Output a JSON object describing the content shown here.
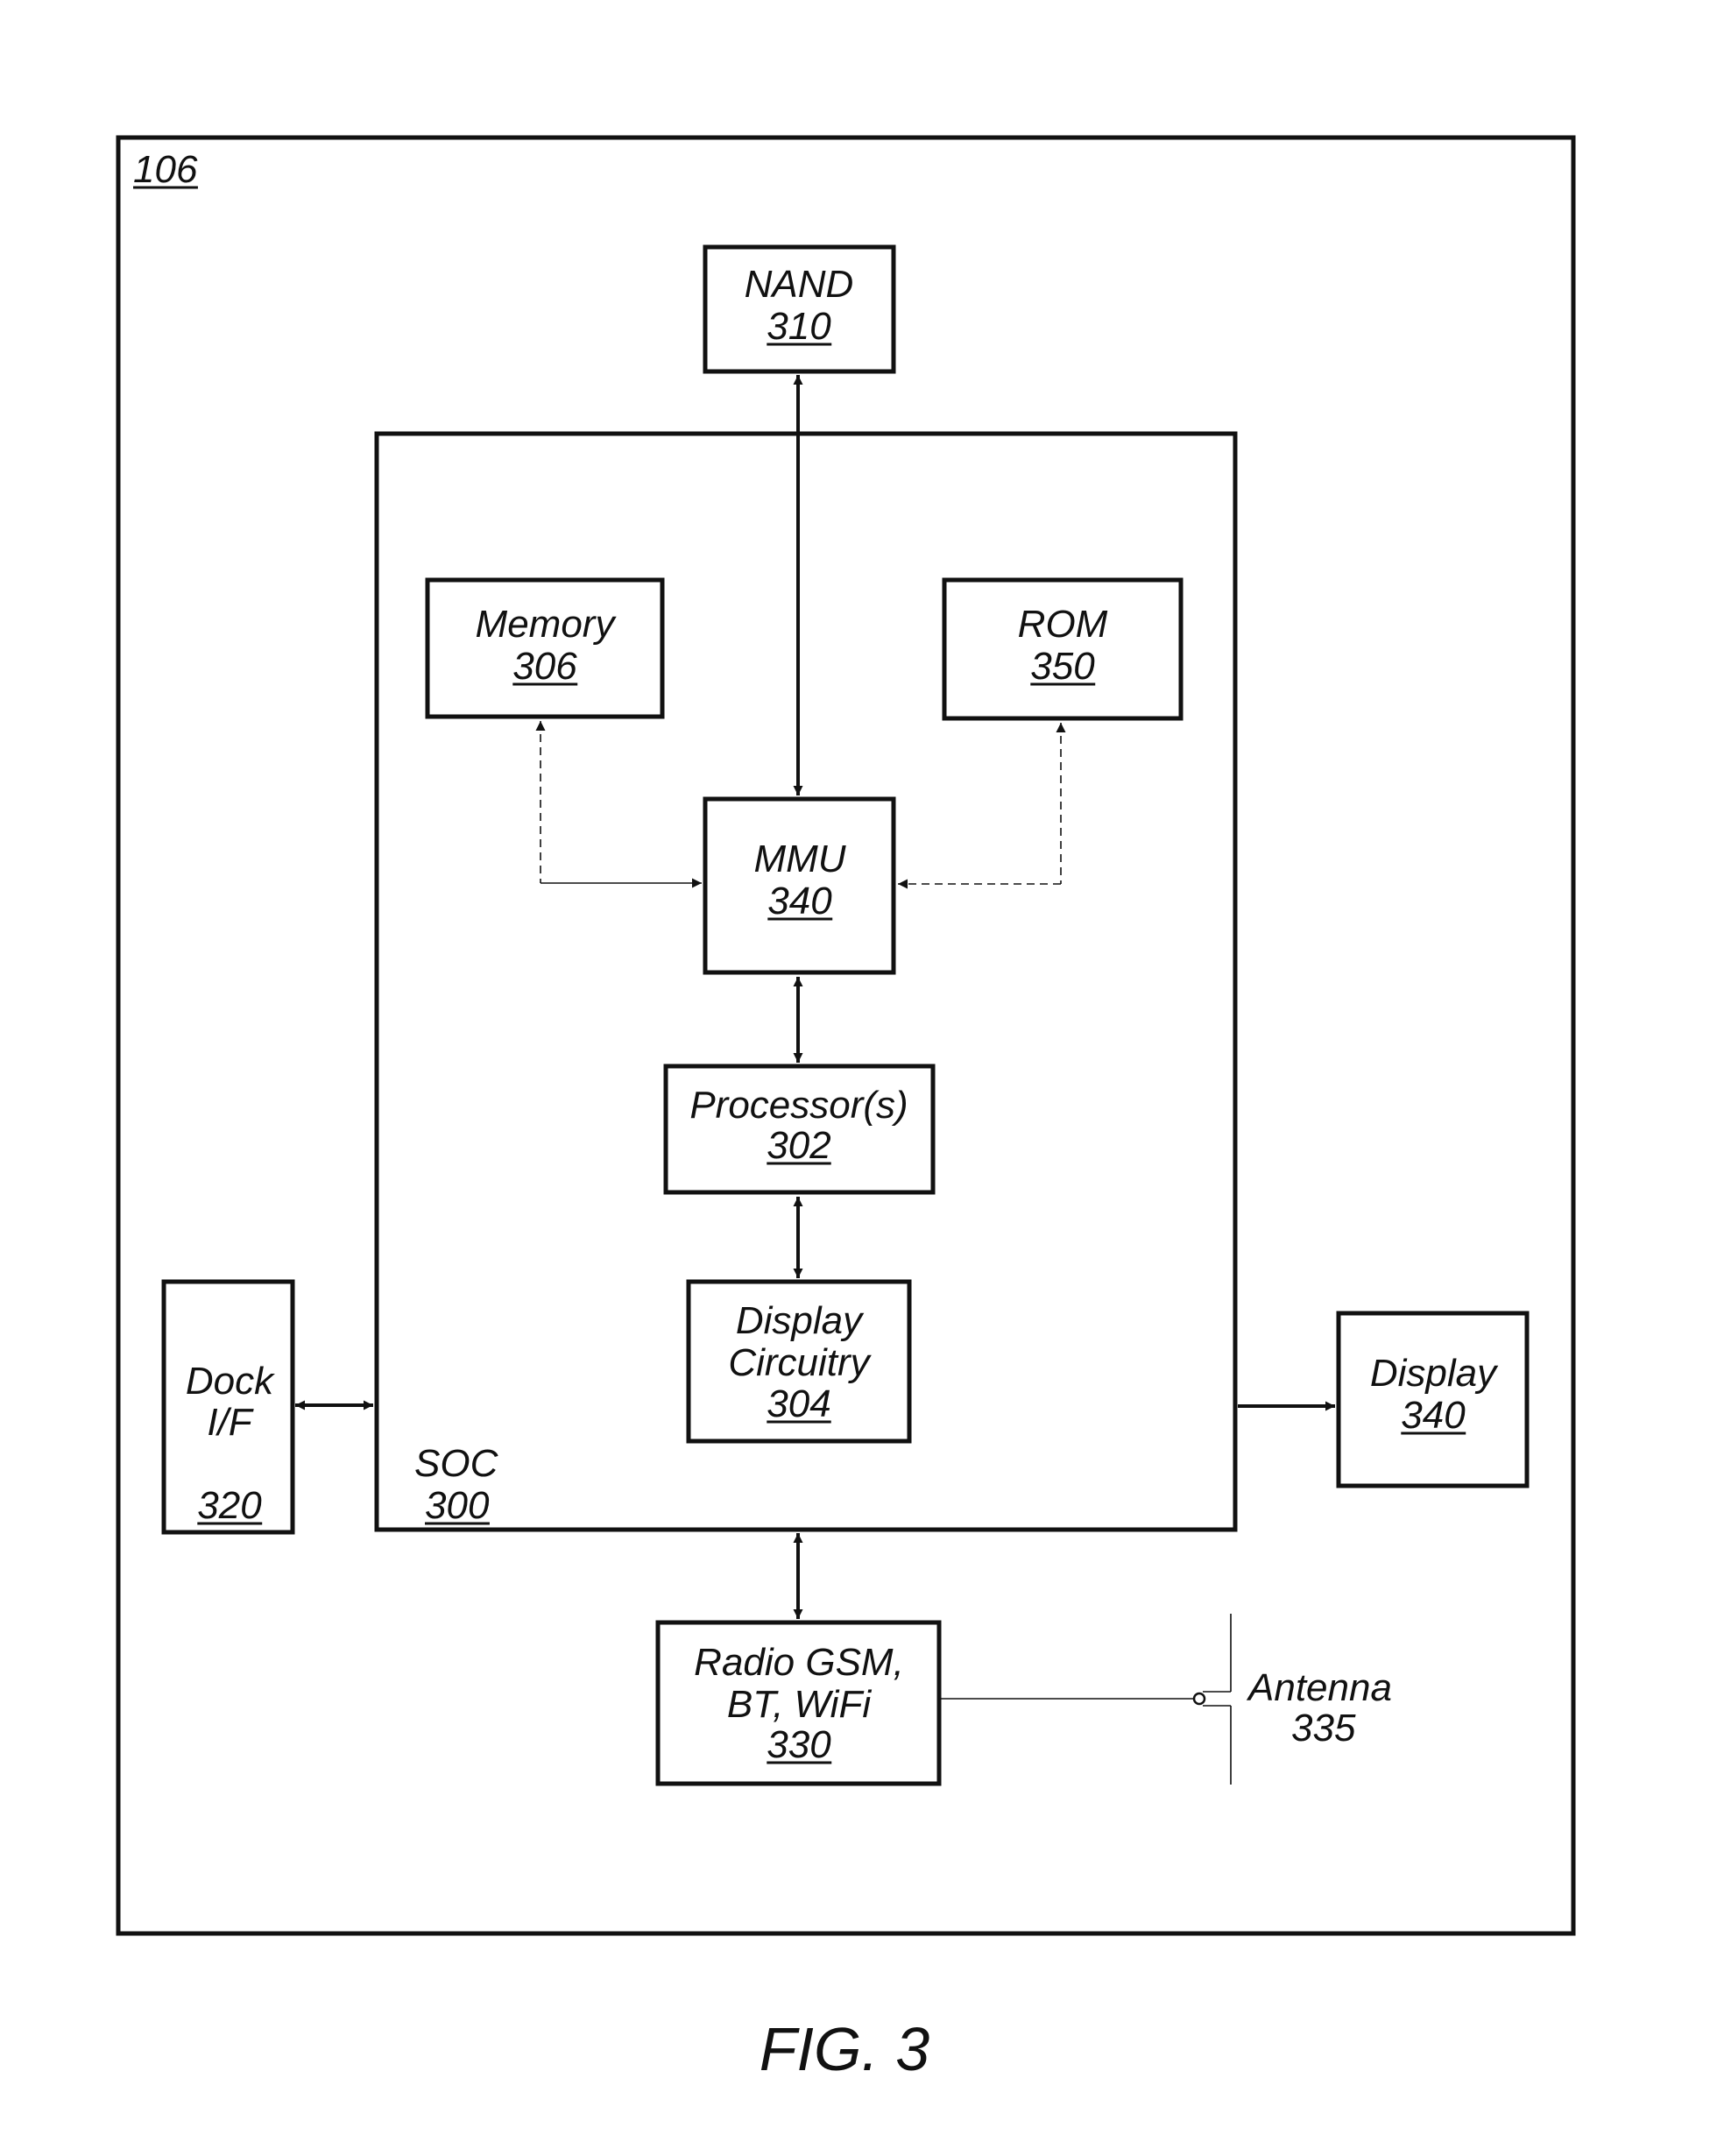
{
  "figure": {
    "caption": "FIG. 3",
    "device_label": "106"
  },
  "blocks": {
    "nand": {
      "name": "NAND",
      "ref": "310"
    },
    "soc": {
      "name": "SOC",
      "ref": "300"
    },
    "memory": {
      "name": "Memory",
      "ref": "306"
    },
    "rom": {
      "name": "ROM",
      "ref": "350"
    },
    "mmu": {
      "name": "MMU",
      "ref": "340"
    },
    "processor": {
      "name": "Processor(s)",
      "ref": "302"
    },
    "display_circuitry": {
      "name_line1": "Display",
      "name_line2": "Circuitry",
      "ref": "304"
    },
    "dock": {
      "name_line1": "Dock",
      "name_line2": "I/F",
      "ref": "320"
    },
    "display": {
      "name": "Display",
      "ref": "340"
    },
    "radio": {
      "name_line1": "Radio GSM,",
      "name_line2": "BT, WiFi",
      "ref": "330"
    },
    "antenna": {
      "name": "Antenna",
      "ref": "335"
    }
  },
  "connections": [
    {
      "from": "NAND 310",
      "to": "MMU 340",
      "style": "solid",
      "direction": "bidirectional"
    },
    {
      "from": "Memory 306",
      "to": "MMU 340",
      "style": "dashed",
      "direction": "bidirectional"
    },
    {
      "from": "ROM 350",
      "to": "MMU 340",
      "style": "dashed",
      "direction": "bidirectional"
    },
    {
      "from": "MMU 340",
      "to": "Processor(s) 302",
      "style": "solid",
      "direction": "bidirectional"
    },
    {
      "from": "Processor(s) 302",
      "to": "Display Circuitry 304",
      "style": "solid",
      "direction": "bidirectional"
    },
    {
      "from": "Dock I/F 320",
      "to": "SOC 300",
      "style": "solid",
      "direction": "bidirectional"
    },
    {
      "from": "SOC 300",
      "to": "Display 340",
      "style": "solid",
      "direction": "unidirectional"
    },
    {
      "from": "SOC 300",
      "to": "Radio GSM, BT, WiFi 330",
      "style": "solid",
      "direction": "bidirectional"
    },
    {
      "from": "Radio GSM, BT, WiFi 330",
      "to": "Antenna 335",
      "style": "solid",
      "direction": "none"
    }
  ]
}
